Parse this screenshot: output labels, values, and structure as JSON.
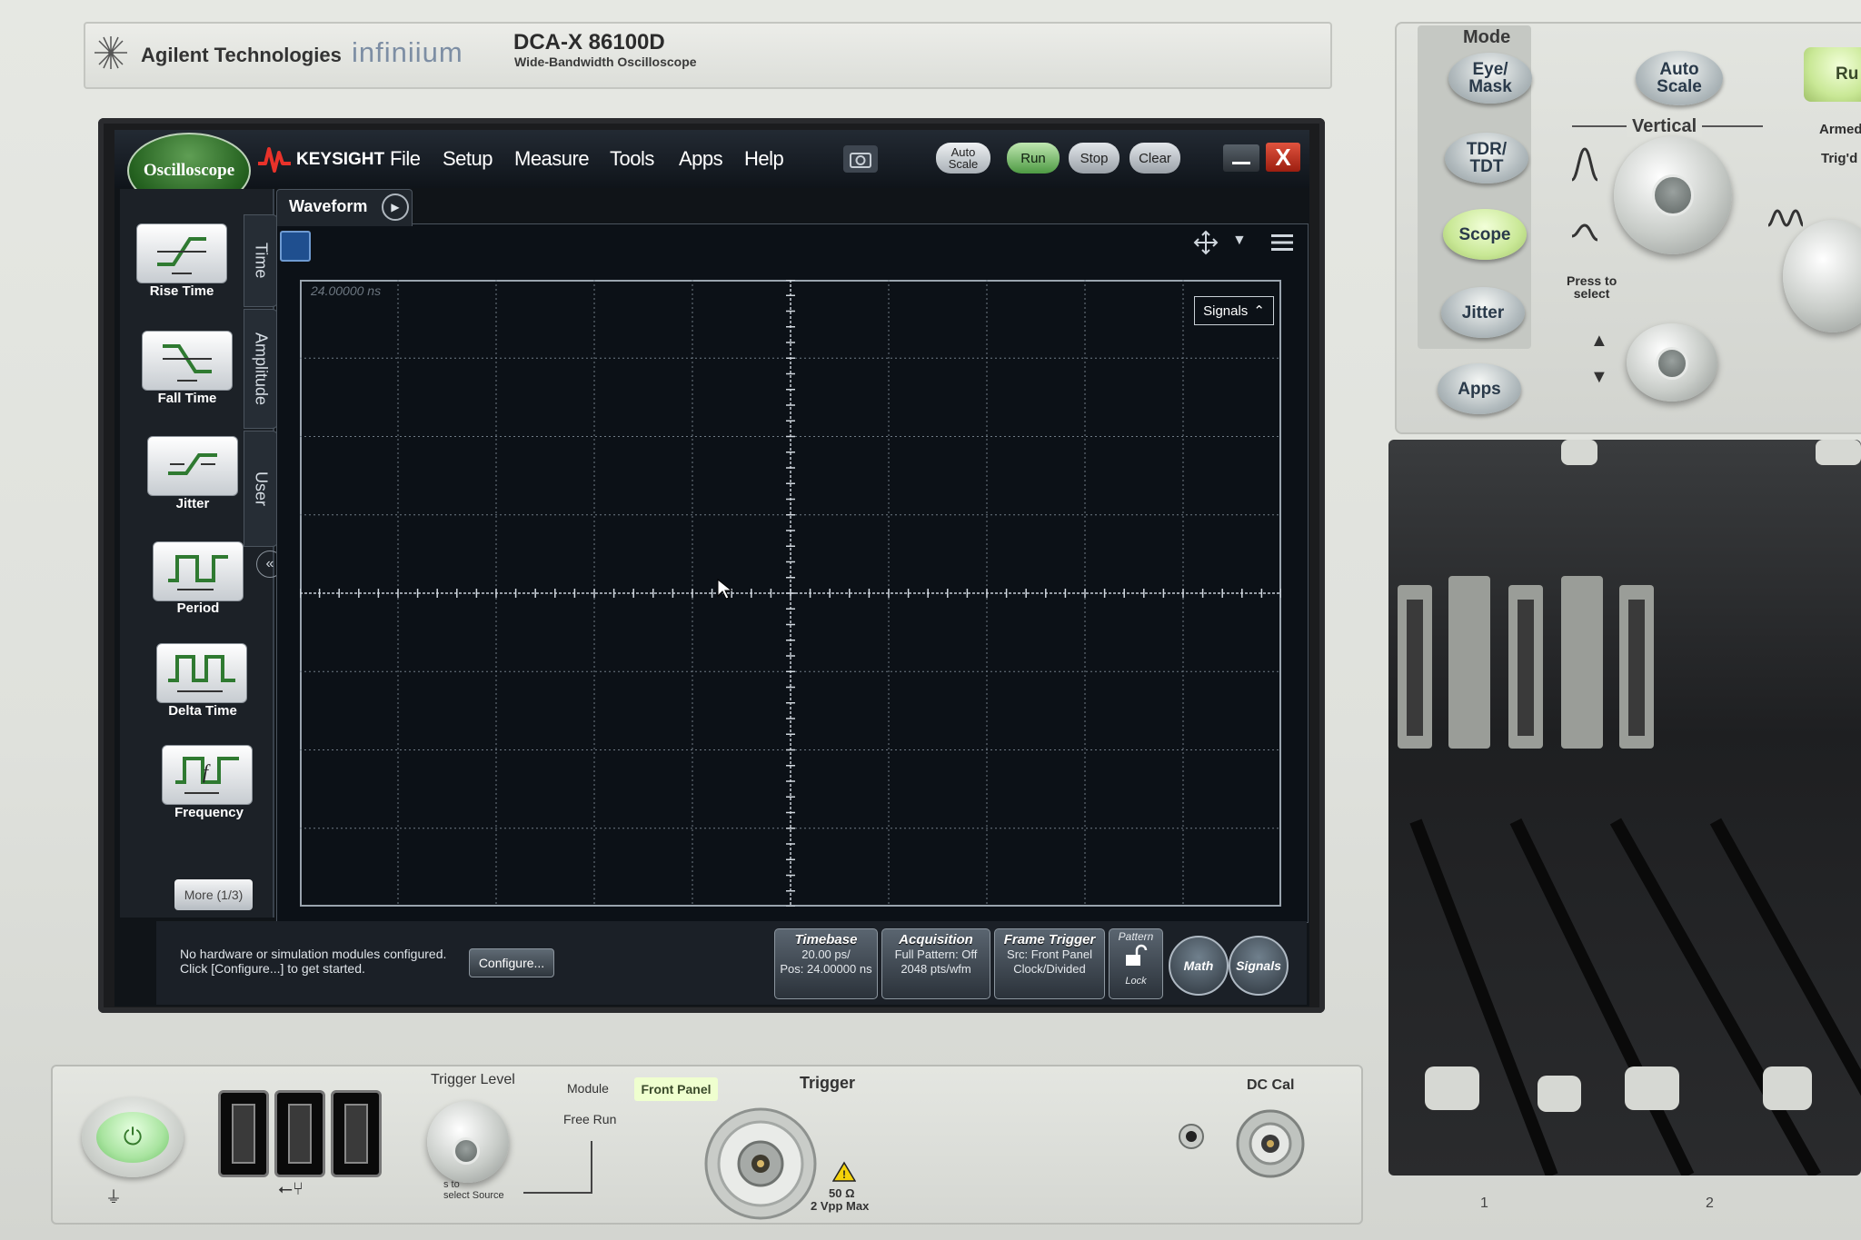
{
  "header": {
    "brand": "Agilent Technologies",
    "product_line": "infiniium",
    "model": "DCA-X  86100D",
    "model_subtitle": "Wide-Bandwidth Oscilloscope"
  },
  "app": {
    "mode_badge": "Oscilloscope",
    "vendor": "KEYSIGHT",
    "menu": [
      "File",
      "Setup",
      "Measure",
      "Tools",
      "Apps",
      "Help"
    ],
    "toolbar": {
      "autoscale_label": "Auto Scale",
      "run_label": "Run",
      "stop_label": "Stop",
      "clear_label": "Clear",
      "close_label": "X"
    }
  },
  "measure_palette": {
    "items": [
      {
        "label": "Rise Time",
        "icon": "rise-time-icon"
      },
      {
        "label": "Fall Time",
        "icon": "fall-time-icon"
      },
      {
        "label": "Jitter",
        "icon": "jitter-icon"
      },
      {
        "label": "Period",
        "icon": "period-icon"
      },
      {
        "label": "Delta Time",
        "icon": "delta-time-icon"
      },
      {
        "label": "Frequency",
        "icon": "frequency-icon"
      }
    ],
    "tabs": [
      "Time",
      "Amplitude",
      "User"
    ],
    "more_label": "More (1/3)"
  },
  "waveform": {
    "tab_label": "Waveform",
    "time_reference": "24.00000 ns",
    "signals_label": "Signals"
  },
  "status_bar": {
    "message_line1": "No hardware or simulation modules configured.",
    "message_line2": "Click [Configure...] to get started.",
    "configure_label": "Configure...",
    "timebase": {
      "title": "Timebase",
      "line1": "20.00 ps/",
      "line2": "Pos: 24.00000 ns"
    },
    "acquisition": {
      "title": "Acquisition",
      "line1": "Full Pattern: Off",
      "line2": "2048 pts/wfm"
    },
    "frame_trigger": {
      "title": "Frame Trigger",
      "line1": "Src: Front Panel",
      "line2": "Clock/Divided"
    },
    "pattern": {
      "title": "Pattern",
      "lock": "Lock"
    },
    "math_label": "Math",
    "signals_label": "Signals"
  },
  "control_panel": {
    "mode_title": "Mode",
    "mode_buttons": [
      "Eye/\nMask",
      "TDR/\nTDT",
      "Scope",
      "Jitter",
      "Apps"
    ],
    "autoscale_label": "Auto\nScale",
    "run_label": "Ru",
    "armed_label": "Armed",
    "trigd_label": "Trig'd",
    "vertical_title": "Vertical",
    "press_to_select": "Press to\nselect"
  },
  "bottom_panel": {
    "trigger_level": "Trigger Level",
    "module": "Module",
    "front_panel": "Front Panel",
    "free_run": "Free Run",
    "trigger": "Trigger",
    "select_source": "s to\nselect Source",
    "impedance": "50 Ω",
    "max_voltage": "2 Vpp Max",
    "dc_cal": "DC Cal",
    "slot_1": "1",
    "slot_2": "2"
  },
  "colors": {
    "run_green": "#4e9a43",
    "close_red": "#c0301f",
    "scope_highlight": "#c9e896",
    "grid_line": "#8f99a3"
  }
}
